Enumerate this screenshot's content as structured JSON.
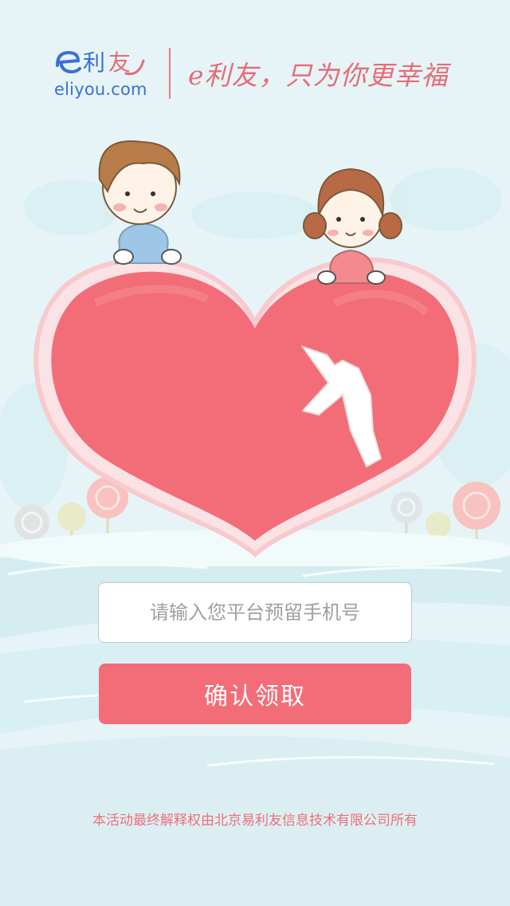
{
  "header": {
    "logo_domain": "eliyou.com",
    "slogan": "e利友，只为你更幸福"
  },
  "form": {
    "phone_placeholder": "请输入您平台预留手机号",
    "submit_label": "确认领取"
  },
  "footer": {
    "disclaimer": "本活动最终解释权由北京易利友信息技术有限公司所有"
  },
  "colors": {
    "accent": "#f36d78",
    "brand_blue": "#3b6fd6",
    "background": "#e4f3f6"
  },
  "icons": [
    "eliyou-logo-icon",
    "boy-illustration",
    "girl-illustration",
    "heart-illustration",
    "hand-pointer-icon",
    "lollipop-tree-icon"
  ]
}
